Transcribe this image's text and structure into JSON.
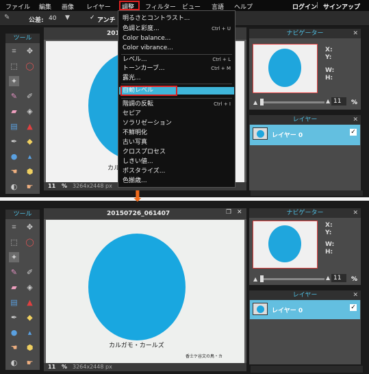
{
  "menubar": {
    "items": [
      "ファイル",
      "編集",
      "画像",
      "レイヤー",
      "調整",
      "フィルター",
      "ビュー",
      "言語",
      "ヘルプ"
    ],
    "login": "ログイン",
    "sep": "|",
    "signup": "サインアップ"
  },
  "options": {
    "tolerance_label": "公差:",
    "tolerance_value": "40",
    "antialias": "アンチ"
  },
  "tools": {
    "title": "ツール"
  },
  "canvas": {
    "title": "20150726_061407",
    "caption": "カルガモ・カールズ",
    "corner_text": "香士ケ谷文の鳥・カ",
    "zoom": "11",
    "zoom_unit": "%",
    "size": "3264x2448 px"
  },
  "navigator": {
    "title": "ナビゲーター",
    "x_label": "X:",
    "y_label": "Y:",
    "w_label": "W:",
    "h_label": "H:",
    "zoom": "11",
    "unit": "%",
    "zoom_fill": 0.11
  },
  "layers": {
    "title": "レイヤー",
    "layer0": "レイヤー 0"
  },
  "menu": {
    "items": [
      {
        "label": "明るさとコントラスト...",
        "key": ""
      },
      {
        "label": "色調と彩度...",
        "key": "Ctrl + U"
      },
      {
        "label": "Color balance...",
        "key": ""
      },
      {
        "label": "Color vibrance...",
        "key": ""
      },
      {
        "label": "レベル...",
        "key": "Ctrl + L"
      },
      {
        "label": "トーンカーブ...",
        "key": "Ctrl + M"
      },
      {
        "label": "露光...",
        "key": ""
      },
      {
        "label": "自動レベル",
        "key": ""
      },
      {
        "label": "階調の反転",
        "key": "Ctrl + I"
      },
      {
        "label": "セピア",
        "key": ""
      },
      {
        "label": "ソラリゼーション",
        "key": ""
      },
      {
        "label": "不鮮明化",
        "key": ""
      },
      {
        "label": "古い写真",
        "key": ""
      },
      {
        "label": "クロスプロセス",
        "key": ""
      },
      {
        "label": "しきい値...",
        "key": ""
      },
      {
        "label": "ポスタライズ...",
        "key": ""
      },
      {
        "label": "色揃歳...",
        "key": ""
      }
    ]
  },
  "arrow": "⬇",
  "icons": [
    "wand-icon",
    "dropdown-arrow-icon",
    "close-icon",
    "maximize-icon",
    "mountain-icon",
    "eye-icon",
    "lock-icon",
    "checkbox-icon"
  ]
}
